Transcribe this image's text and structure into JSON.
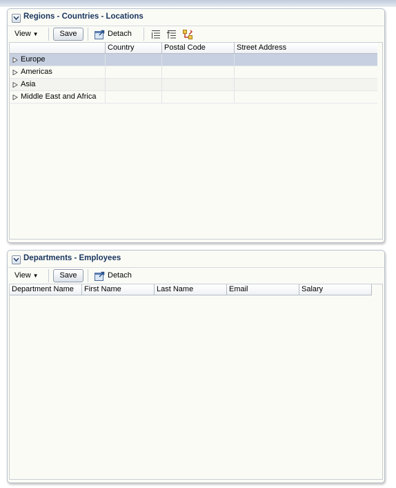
{
  "panels": {
    "regions": {
      "title": "Regions - Countries - Locations",
      "toolbar": {
        "view_label": "View",
        "save_label": "Save",
        "detach_label": "Detach"
      },
      "columns": [
        "",
        "Country",
        "Postal Code",
        "Street Address"
      ],
      "rows": [
        {
          "label": "Europe",
          "selected": true
        },
        {
          "label": "Americas",
          "selected": false
        },
        {
          "label": "Asia",
          "selected": false
        },
        {
          "label": "Middle East and Africa",
          "selected": false
        }
      ]
    },
    "departments": {
      "title": "Departments - Employees",
      "toolbar": {
        "view_label": "View",
        "save_label": "Save",
        "detach_label": "Detach"
      },
      "columns": [
        "Department Name",
        "First Name",
        "Last Name",
        "Email",
        "Salary"
      ]
    }
  },
  "colors": {
    "title": "#18345d",
    "selected_row": "#c6d0e0",
    "panel_bg": "#fbfbf6"
  }
}
